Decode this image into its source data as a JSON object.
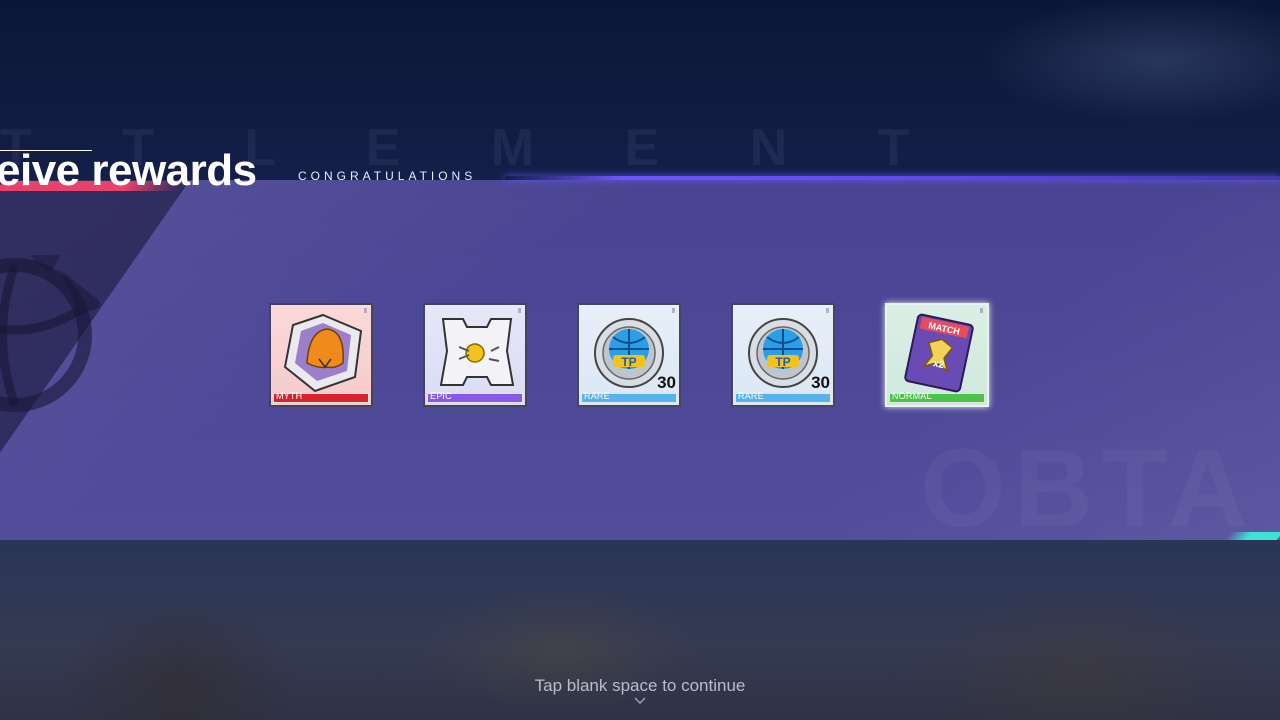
{
  "header": {
    "watermark": "T T L E M E N T",
    "title": "eive rewards",
    "subtitle": "CONGRATULATIONS"
  },
  "panel": {
    "ghost_text": "OBTA"
  },
  "rewards": [
    {
      "rarity": "MYTH",
      "quantity": "",
      "icon": "avatar-frame-icon",
      "color": "#d8222e"
    },
    {
      "rarity": "EPIC",
      "quantity": "",
      "icon": "skill-ticket-icon",
      "color": "#8a58e6"
    },
    {
      "rarity": "RARE",
      "quantity": "30",
      "icon": "tp-basketball-coin-icon",
      "color": "#56b3ec"
    },
    {
      "rarity": "RARE",
      "quantity": "30",
      "icon": "tp-basketball-coin-icon",
      "color": "#56b3ec"
    },
    {
      "rarity": "NORMAL",
      "quantity": "",
      "icon": "match-double-card-icon",
      "color": "#4cc34a"
    }
  ],
  "footer": {
    "continue_text": "Tap blank space to continue"
  },
  "colors": {
    "accent_pink": "#e8416b",
    "accent_purple": "#6b57ff",
    "panel": "#4d4896",
    "accent_teal": "#3fe0d5"
  }
}
